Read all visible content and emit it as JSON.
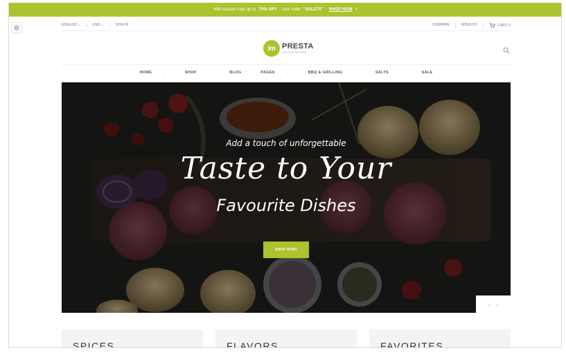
{
  "promo": {
    "text_pre": "Mid-season sale up to",
    "discount": "70% OFF",
    "text_mid": ". Use code",
    "code": "\"SALE70\"",
    "link": "SHOP NOW",
    "link_arrow": ">"
  },
  "topbar": {
    "language": "ENGLISH",
    "currency": "USD",
    "sign_in": "SIGN IN",
    "compare": "COMPARE",
    "wishlist": "WISHLIST",
    "cart": "CART: 0"
  },
  "logo": {
    "mark": "im",
    "name": "PRESTA",
    "tagline": "SPICES STORE"
  },
  "nav": {
    "items": [
      {
        "label": "HOME",
        "has_submenu": true
      },
      {
        "label": "SHOP",
        "has_submenu": true
      },
      {
        "label": "BLOG",
        "has_submenu": false
      },
      {
        "label": "PAGES",
        "has_submenu": true
      },
      {
        "label": "BBQ & GRILLING",
        "has_submenu": true
      },
      {
        "label": "SALTS",
        "has_submenu": true
      },
      {
        "label": "SALE",
        "has_submenu": false
      }
    ]
  },
  "hero": {
    "subtitle": "Add a touch of unforgettable",
    "title": "Taste to Your",
    "title2": "Favourite Dishes",
    "button": "SHOP NOW!",
    "prev": "‹",
    "next": "›"
  },
  "categories": [
    {
      "label": "SPICES"
    },
    {
      "label": "FLAVORS"
    },
    {
      "label": "FAVORITES"
    }
  ],
  "colors": {
    "accent": "#acc22f",
    "hero_bg": "#1b1c1b"
  },
  "icons": [
    "gear-icon",
    "search-icon",
    "cart-icon",
    "chevron-down-icon",
    "chevron-left-icon",
    "chevron-right-icon"
  ]
}
